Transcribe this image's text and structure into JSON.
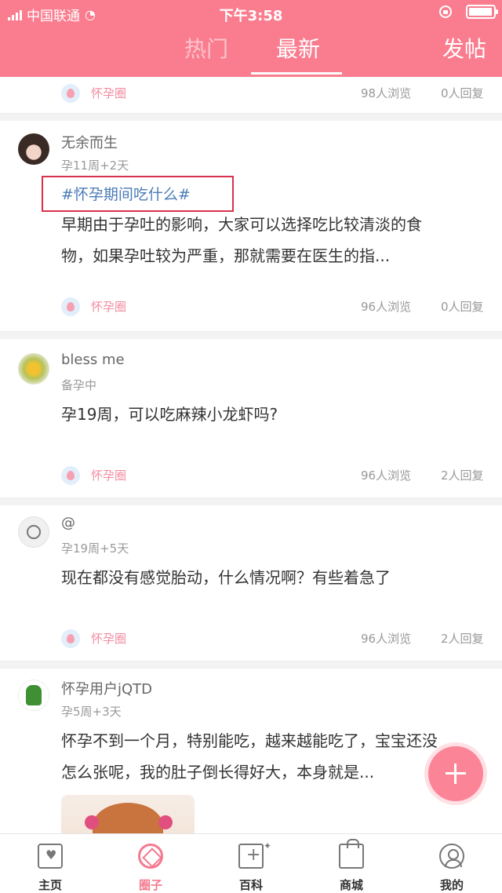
{
  "status_bar": {
    "carrier": "中国联通",
    "time": "下午3:58",
    "battery_level": 0.95
  },
  "header": {
    "tabs": [
      {
        "label": "热门",
        "active": false
      },
      {
        "label": "最新",
        "active": true
      }
    ],
    "post_button": "发帖"
  },
  "feed": {
    "top_meta": {
      "circle": "怀孕圈",
      "views": "98人浏览",
      "replies": "0人回复"
    },
    "posts": [
      {
        "username": "无余而生",
        "stage": "孕11周+2天",
        "topic": "#怀孕期间吃什么#",
        "text_line1": "早期由于孕吐的影响，大家可以选择吃比较清淡的食",
        "text_line2": "物，如果孕吐较为严重，那就需要在医生的指...",
        "circle": "怀孕圈",
        "views": "96人浏览",
        "replies": "0人回复"
      },
      {
        "username": "bless me",
        "stage": "备孕中",
        "text_line1": "孕19周，可以吃麻辣小龙虾吗?",
        "circle": "怀孕圈",
        "views": "96人浏览",
        "replies": "2人回复"
      },
      {
        "username": "@",
        "stage": "孕19周+5天",
        "text_line1": "现在都没有感觉胎动，什么情况啊？有些着急了",
        "circle": "怀孕圈",
        "views": "96人浏览",
        "replies": "2人回复"
      },
      {
        "username": "怀孕用户jQTD",
        "stage": "孕5周+3天",
        "text_line1": "怀孕不到一个月，特别能吃，越来越能吃了，宝宝还没",
        "text_line2": "怎么张呢，我的肚子倒长得好大，本身就是..."
      }
    ]
  },
  "bottom_nav": [
    {
      "label": "主页",
      "icon": "home-icon",
      "active": false
    },
    {
      "label": "圈子",
      "icon": "circle-icon",
      "active": true
    },
    {
      "label": "百科",
      "icon": "wiki-icon",
      "active": false
    },
    {
      "label": "商城",
      "icon": "shopping-bag-icon",
      "active": false
    },
    {
      "label": "我的",
      "icon": "profile-icon",
      "active": false
    }
  ],
  "colors": {
    "brand": "#fa7d8f",
    "topic_link": "#4b7bb6",
    "highlight_box": "#d9314b"
  }
}
